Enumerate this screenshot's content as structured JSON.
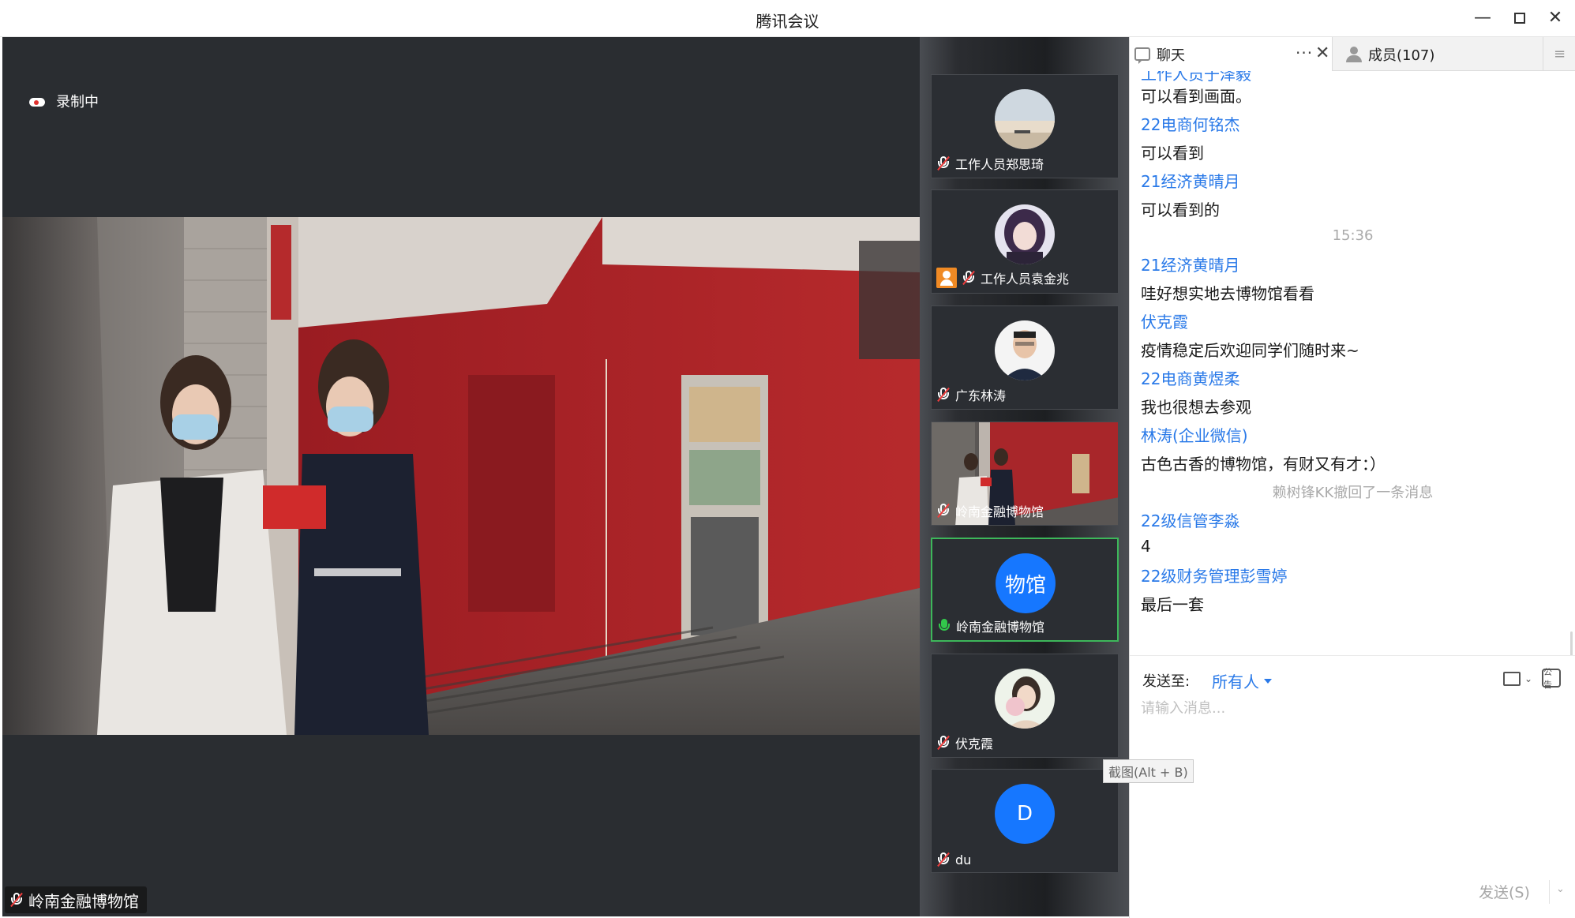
{
  "window": {
    "title": "腾讯会议",
    "controls": {
      "minimize": "—",
      "maximize": "",
      "close": "✕"
    }
  },
  "main_stage": {
    "recording_label": "录制中",
    "speaker_name": "岭南金融博物馆"
  },
  "participants": [
    {
      "name": "工作人员郑思琦",
      "mic": "muted",
      "host": false
    },
    {
      "name": "工作人员袁金兆",
      "mic": "muted",
      "host": true
    },
    {
      "name": "广东林涛",
      "mic": "muted",
      "host": false
    },
    {
      "name": "岭南金融博物馆",
      "mic": "muted",
      "host": false,
      "video": true
    },
    {
      "name": "岭南金融博物馆",
      "mic": "on",
      "host": false,
      "avatar_text": "物馆",
      "active": true
    },
    {
      "name": "伏克霞",
      "mic": "muted",
      "host": false
    },
    {
      "name": "du",
      "mic": "muted",
      "host": false,
      "avatar_text": "D"
    }
  ],
  "chat_panel": {
    "tab_chat": "聊天",
    "tab_more": "···",
    "tab_close": "✕",
    "tab_members": "成员(107)",
    "menu": "≡",
    "messages": [
      {
        "type": "sender",
        "text": "工作人员于泽毅"
      },
      {
        "type": "text",
        "text": "可以看到画面。"
      },
      {
        "type": "sender",
        "text": "22电商何铭杰"
      },
      {
        "type": "text",
        "text": "可以看到"
      },
      {
        "type": "sender",
        "text": "21经济黄晴月"
      },
      {
        "type": "text",
        "text": "可以看到的"
      },
      {
        "type": "time",
        "text": "15:36"
      },
      {
        "type": "sender",
        "text": "21经济黄晴月"
      },
      {
        "type": "text",
        "text": "哇好想实地去博物馆看看"
      },
      {
        "type": "sender",
        "text": "伏克霞"
      },
      {
        "type": "text",
        "text": "疫情稳定后欢迎同学们随时来~"
      },
      {
        "type": "sender",
        "text": "22电商黄煜柔"
      },
      {
        "type": "text",
        "text": "我也很想去参观"
      },
      {
        "type": "sender",
        "text": "林涛(企业微信)"
      },
      {
        "type": "text",
        "text": "古色古香的博物馆，有财又有才：）"
      },
      {
        "type": "system",
        "text": "赖树锋KK撤回了一条消息"
      },
      {
        "type": "sender",
        "text": "22级信管李淼"
      },
      {
        "type": "text",
        "text": "4"
      },
      {
        "type": "sender",
        "text": "22级财务管理彭雪婷"
      },
      {
        "type": "text",
        "text": "最后一套"
      }
    ],
    "send_to_label": "发送至:",
    "recipient": "所有人",
    "input_placeholder": "请输入消息...",
    "send_button": "发送(S)",
    "send_caret": "⌄",
    "notice_icon_label": "公告"
  },
  "tooltip": "截图(Alt + B)"
}
